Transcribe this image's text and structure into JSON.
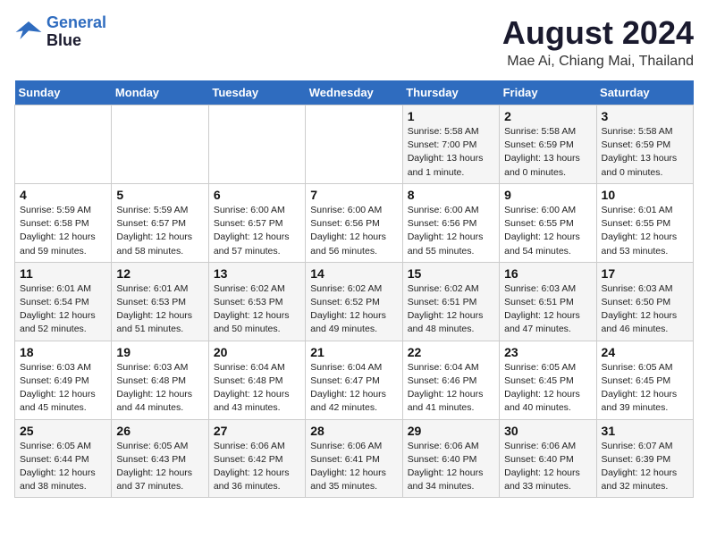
{
  "header": {
    "logo_line1": "General",
    "logo_line2": "Blue",
    "main_title": "August 2024",
    "subtitle": "Mae Ai, Chiang Mai, Thailand"
  },
  "weekdays": [
    "Sunday",
    "Monday",
    "Tuesday",
    "Wednesday",
    "Thursday",
    "Friday",
    "Saturday"
  ],
  "weeks": [
    [
      {
        "day": "",
        "info": ""
      },
      {
        "day": "",
        "info": ""
      },
      {
        "day": "",
        "info": ""
      },
      {
        "day": "",
        "info": ""
      },
      {
        "day": "1",
        "info": "Sunrise: 5:58 AM\nSunset: 7:00 PM\nDaylight: 13 hours\nand 1 minute."
      },
      {
        "day": "2",
        "info": "Sunrise: 5:58 AM\nSunset: 6:59 PM\nDaylight: 13 hours\nand 0 minutes."
      },
      {
        "day": "3",
        "info": "Sunrise: 5:58 AM\nSunset: 6:59 PM\nDaylight: 13 hours\nand 0 minutes."
      }
    ],
    [
      {
        "day": "4",
        "info": "Sunrise: 5:59 AM\nSunset: 6:58 PM\nDaylight: 12 hours\nand 59 minutes."
      },
      {
        "day": "5",
        "info": "Sunrise: 5:59 AM\nSunset: 6:57 PM\nDaylight: 12 hours\nand 58 minutes."
      },
      {
        "day": "6",
        "info": "Sunrise: 6:00 AM\nSunset: 6:57 PM\nDaylight: 12 hours\nand 57 minutes."
      },
      {
        "day": "7",
        "info": "Sunrise: 6:00 AM\nSunset: 6:56 PM\nDaylight: 12 hours\nand 56 minutes."
      },
      {
        "day": "8",
        "info": "Sunrise: 6:00 AM\nSunset: 6:56 PM\nDaylight: 12 hours\nand 55 minutes."
      },
      {
        "day": "9",
        "info": "Sunrise: 6:00 AM\nSunset: 6:55 PM\nDaylight: 12 hours\nand 54 minutes."
      },
      {
        "day": "10",
        "info": "Sunrise: 6:01 AM\nSunset: 6:55 PM\nDaylight: 12 hours\nand 53 minutes."
      }
    ],
    [
      {
        "day": "11",
        "info": "Sunrise: 6:01 AM\nSunset: 6:54 PM\nDaylight: 12 hours\nand 52 minutes."
      },
      {
        "day": "12",
        "info": "Sunrise: 6:01 AM\nSunset: 6:53 PM\nDaylight: 12 hours\nand 51 minutes."
      },
      {
        "day": "13",
        "info": "Sunrise: 6:02 AM\nSunset: 6:53 PM\nDaylight: 12 hours\nand 50 minutes."
      },
      {
        "day": "14",
        "info": "Sunrise: 6:02 AM\nSunset: 6:52 PM\nDaylight: 12 hours\nand 49 minutes."
      },
      {
        "day": "15",
        "info": "Sunrise: 6:02 AM\nSunset: 6:51 PM\nDaylight: 12 hours\nand 48 minutes."
      },
      {
        "day": "16",
        "info": "Sunrise: 6:03 AM\nSunset: 6:51 PM\nDaylight: 12 hours\nand 47 minutes."
      },
      {
        "day": "17",
        "info": "Sunrise: 6:03 AM\nSunset: 6:50 PM\nDaylight: 12 hours\nand 46 minutes."
      }
    ],
    [
      {
        "day": "18",
        "info": "Sunrise: 6:03 AM\nSunset: 6:49 PM\nDaylight: 12 hours\nand 45 minutes."
      },
      {
        "day": "19",
        "info": "Sunrise: 6:03 AM\nSunset: 6:48 PM\nDaylight: 12 hours\nand 44 minutes."
      },
      {
        "day": "20",
        "info": "Sunrise: 6:04 AM\nSunset: 6:48 PM\nDaylight: 12 hours\nand 43 minutes."
      },
      {
        "day": "21",
        "info": "Sunrise: 6:04 AM\nSunset: 6:47 PM\nDaylight: 12 hours\nand 42 minutes."
      },
      {
        "day": "22",
        "info": "Sunrise: 6:04 AM\nSunset: 6:46 PM\nDaylight: 12 hours\nand 41 minutes."
      },
      {
        "day": "23",
        "info": "Sunrise: 6:05 AM\nSunset: 6:45 PM\nDaylight: 12 hours\nand 40 minutes."
      },
      {
        "day": "24",
        "info": "Sunrise: 6:05 AM\nSunset: 6:45 PM\nDaylight: 12 hours\nand 39 minutes."
      }
    ],
    [
      {
        "day": "25",
        "info": "Sunrise: 6:05 AM\nSunset: 6:44 PM\nDaylight: 12 hours\nand 38 minutes."
      },
      {
        "day": "26",
        "info": "Sunrise: 6:05 AM\nSunset: 6:43 PM\nDaylight: 12 hours\nand 37 minutes."
      },
      {
        "day": "27",
        "info": "Sunrise: 6:06 AM\nSunset: 6:42 PM\nDaylight: 12 hours\nand 36 minutes."
      },
      {
        "day": "28",
        "info": "Sunrise: 6:06 AM\nSunset: 6:41 PM\nDaylight: 12 hours\nand 35 minutes."
      },
      {
        "day": "29",
        "info": "Sunrise: 6:06 AM\nSunset: 6:40 PM\nDaylight: 12 hours\nand 34 minutes."
      },
      {
        "day": "30",
        "info": "Sunrise: 6:06 AM\nSunset: 6:40 PM\nDaylight: 12 hours\nand 33 minutes."
      },
      {
        "day": "31",
        "info": "Sunrise: 6:07 AM\nSunset: 6:39 PM\nDaylight: 12 hours\nand 32 minutes."
      }
    ]
  ]
}
